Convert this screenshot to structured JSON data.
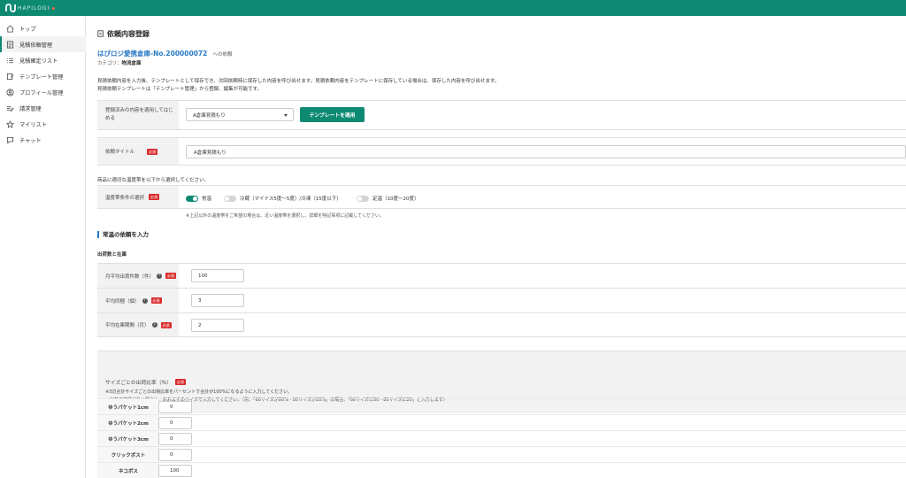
{
  "header": {
    "logo_text": "HAPILOGI",
    "brand_color": "#0e8a73"
  },
  "sidebar": {
    "items": [
      {
        "label": "トップ",
        "icon": "home-icon"
      },
      {
        "label": "見積依頼管理",
        "icon": "document-icon",
        "active": true
      },
      {
        "label": "見積確定リスト",
        "icon": "list-icon"
      },
      {
        "label": "テンプレート管理",
        "icon": "template-icon"
      },
      {
        "label": "プロフィール管理",
        "icon": "profile-icon"
      },
      {
        "label": "請求管理",
        "icon": "invoice-icon"
      },
      {
        "label": "マイリスト",
        "icon": "star-icon"
      },
      {
        "label": "チャット",
        "icon": "chat-icon"
      }
    ]
  },
  "page": {
    "title": "依頼内容登録",
    "warehouse_name": "はぴロジ愛携倉庫-No.200000072",
    "warehouse_suffix": "への依頼",
    "category_label": "カテゴリ：",
    "category_value": "物流倉庫",
    "desc_lines": [
      "見積依頼内容を入力後、テンプレートとして保存でき、次回依頼時に保存した内容を呼び出せます。見積依頼内容をテンプレートに保存している場合は、保存した内容を呼び出せます。",
      "見積依頼テンプレートは「テンプレート管理」から登録、編集が可能です。"
    ]
  },
  "template_row": {
    "label": "登録済みの内容を適用してはじめる",
    "selected": "A倉庫見積もり",
    "apply_button": "テンプレートを適用"
  },
  "title_row": {
    "label": "依頼タイトル",
    "required": "必須",
    "value": "A倉庫見積もり"
  },
  "temperature": {
    "intro": "商品に適切な温度帯を以下から選択してください。",
    "label": "温度帯条件の選択",
    "required": "必須",
    "options": [
      {
        "label": "常温",
        "on": true
      },
      {
        "label": "冷蔵（マイナス5度〜5度）/冷凍（15度以下）",
        "on": false
      },
      {
        "label": "定温（10度〜20度）",
        "on": false
      }
    ],
    "note": "※上記以外の温度帯をご希望の場合は、近い温度帯を選択し、詳細を特記事項に記載してください。"
  },
  "section": {
    "heading": "常温の依頼を入力",
    "subheading": "出荷数と在庫"
  },
  "quantity_rows": [
    {
      "label": "月平均出荷件数（件）",
      "help": true,
      "required": "必須",
      "value": "100"
    },
    {
      "label": "平均同梱（個）",
      "help": true,
      "required": "必須",
      "value": "3"
    },
    {
      "label": "平均在庫期間（月）",
      "help": true,
      "required": "必須",
      "value": "2"
    }
  ],
  "size_ratio": {
    "title": "サイズごとの出荷比率（%）",
    "required": "必須",
    "notes": [
      "※3辺合計サイズごとの出荷比率をパーセントで合計が100%になるように入力してください。",
      "出荷の実績がない場合は、おおよそのサイズで入力してください。（例：「60サイズが80%・80サイズが20%」の場合、「60サイズに80・80サイズに20」と入力します）"
    ],
    "rows": [
      {
        "label": "ゆうパケット1cm",
        "value": "0"
      },
      {
        "label": "ゆうパケット2cm",
        "value": "0"
      },
      {
        "label": "ゆうパケット3cm",
        "value": "0"
      },
      {
        "label": "クリックポスト",
        "value": "0"
      },
      {
        "label": "ネコポス",
        "value": "100"
      }
    ]
  }
}
